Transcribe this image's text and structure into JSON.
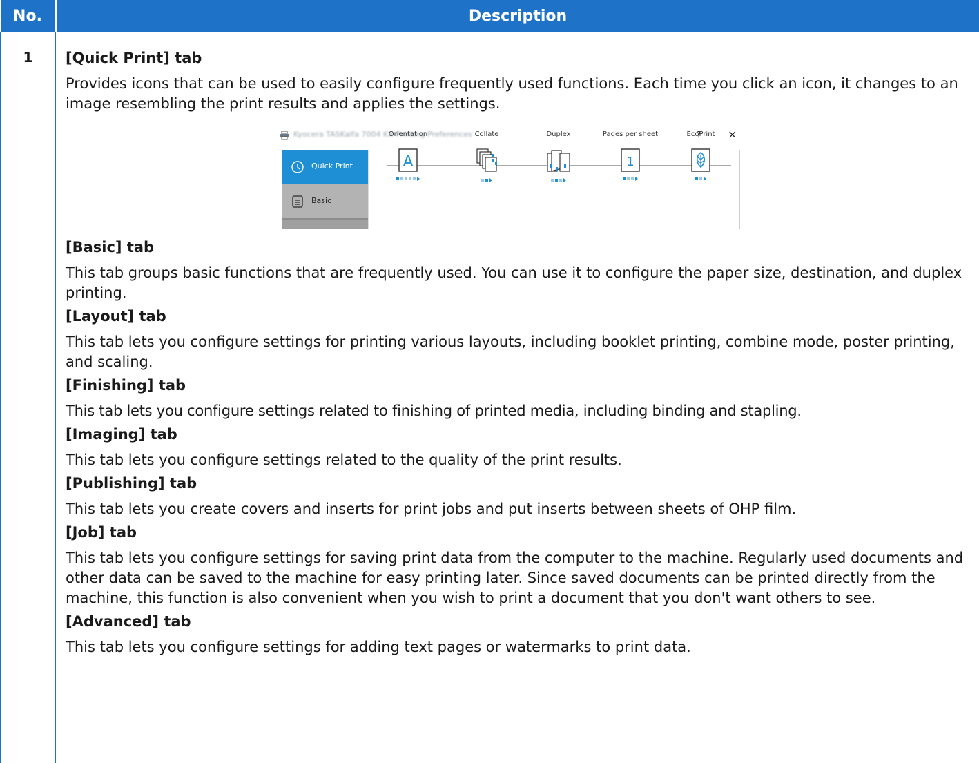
{
  "header": {
    "no": "No.",
    "description": "Description"
  },
  "row": {
    "number": "1",
    "sections": [
      {
        "title": "[Quick Print] tab",
        "desc": "Provides icons that can be used to easily configure frequently used functions. Each time you click an icon, it changes to an image resembling the print results and applies the settings."
      },
      {
        "title": "[Basic] tab",
        "desc": "This tab groups basic functions that are frequently used. You can use it to configure the paper size, destination, and duplex printing."
      },
      {
        "title": "[Layout] tab",
        "desc": "This tab lets you configure settings for printing various layouts, including booklet printing, combine mode, poster printing, and scaling."
      },
      {
        "title": "[Finishing] tab",
        "desc": "This tab lets you configure settings related to finishing of printed media, including binding and stapling."
      },
      {
        "title": "[Imaging] tab",
        "desc": "This tab lets you configure settings related to the quality of the print results."
      },
      {
        "title": "[Publishing] tab",
        "desc": "This tab lets you create covers and inserts for print jobs and put inserts between sheets of OHP film."
      },
      {
        "title": "[Job] tab",
        "desc": "This tab lets you configure settings for saving print data from the computer to the machine. Regularly used documents and other data can be saved to the machine for easy printing later. Since saved documents can be printed directly from the machine, this function is also convenient when you wish to print a document that you don't want others to see."
      },
      {
        "title": "[Advanced] tab",
        "desc": "This tab lets you configure settings for adding text pages or watermarks to print data."
      }
    ]
  },
  "screenshot": {
    "window_title": "Kyocera TASKalfa 7004 KX Printing Preferences",
    "help": "?",
    "close": "×",
    "sidebar": [
      {
        "label": "Quick Print",
        "icon": "clock-icon"
      },
      {
        "label": "Basic",
        "icon": "document-icon"
      }
    ],
    "columns": [
      {
        "label": "Orientation",
        "icon": "orientation-icon"
      },
      {
        "label": "Collate",
        "icon": "collate-icon"
      },
      {
        "label": "Duplex",
        "icon": "duplex-icon"
      },
      {
        "label": "Pages per sheet",
        "icon": "pages-per-sheet-icon",
        "value": "1"
      },
      {
        "label": "EcoPrint",
        "icon": "ecoprint-leaf-icon"
      }
    ],
    "icon_glyph_orientation": "A",
    "accent": "#1e8fd4",
    "header_color": "#1e73c8"
  }
}
